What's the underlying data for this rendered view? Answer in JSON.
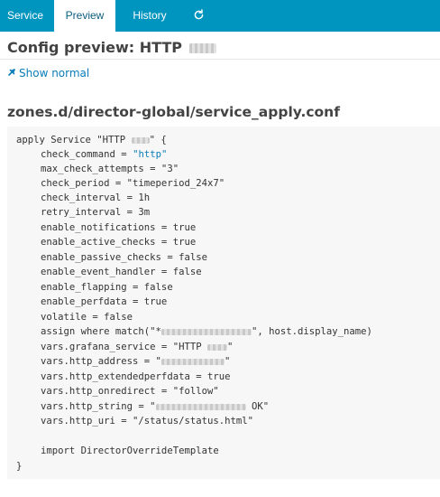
{
  "tabs": {
    "service": "Service",
    "preview": "Preview",
    "history": "History",
    "refresh_icon": "refresh-icon"
  },
  "header": {
    "title": "Config preview: HTTP"
  },
  "actions": {
    "show_normal": "Show normal",
    "show_normal_icon": "pin-icon"
  },
  "file": {
    "path": "zones.d/director-global/service_apply.conf"
  },
  "config": {
    "open": "apply Service \"HTTP ",
    "open_end": "\" {",
    "check_command_key": "check_command = ",
    "check_command_val": "\"http\"",
    "max_check_attempts": "max_check_attempts = \"3\"",
    "check_period": "check_period = \"timeperiod_24x7\"",
    "check_interval": "check_interval = 1h",
    "retry_interval": "retry_interval = 3m",
    "enable_notifications": "enable_notifications = true",
    "enable_active_checks": "enable_active_checks = true",
    "enable_passive_checks": "enable_passive_checks = false",
    "enable_event_handler": "enable_event_handler = false",
    "enable_flapping": "enable_flapping = false",
    "enable_perfdata": "enable_perfdata = true",
    "volatile": "volatile = false",
    "assign_start": "assign where match(\"*",
    "assign_end": "\", host.display_name)",
    "grafana_start": "vars.grafana_service = \"HTTP ",
    "grafana_end": "\"",
    "http_address_start": "vars.http_address = \"",
    "http_address_end": "\"",
    "http_extendedperfdata": "vars.http_extendedperfdata = true",
    "http_onredirect": "vars.http_onredirect = \"follow\"",
    "http_string_start": "vars.http_string = \"",
    "http_string_end": " OK\"",
    "http_uri": "vars.http_uri = \"/status/status.html\"",
    "import": "import DirectorOverrideTemplate",
    "close": "}"
  }
}
